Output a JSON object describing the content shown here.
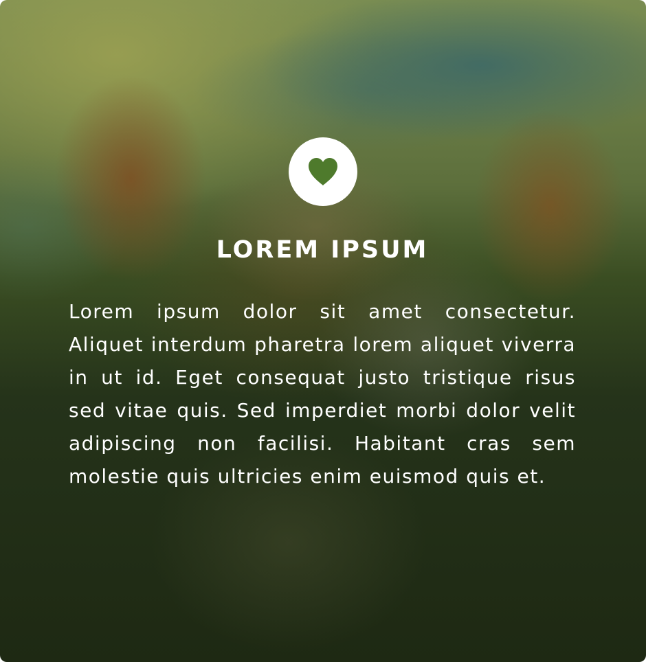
{
  "card": {
    "icon": "heart-icon",
    "icon_color": "#4e7a2c",
    "title": "LOREM IPSUM",
    "body": "Lorem ipsum dolor sit amet consectetur. Aliquet interdum pharetra lorem aliquet viverra in ut id. Eget consequat justo tristique risus sed vitae quis. Sed imperdiet morbi dolor velit adipiscing non facilisi. Habitant cras sem molestie quis ultricies enim euismod quis et."
  }
}
